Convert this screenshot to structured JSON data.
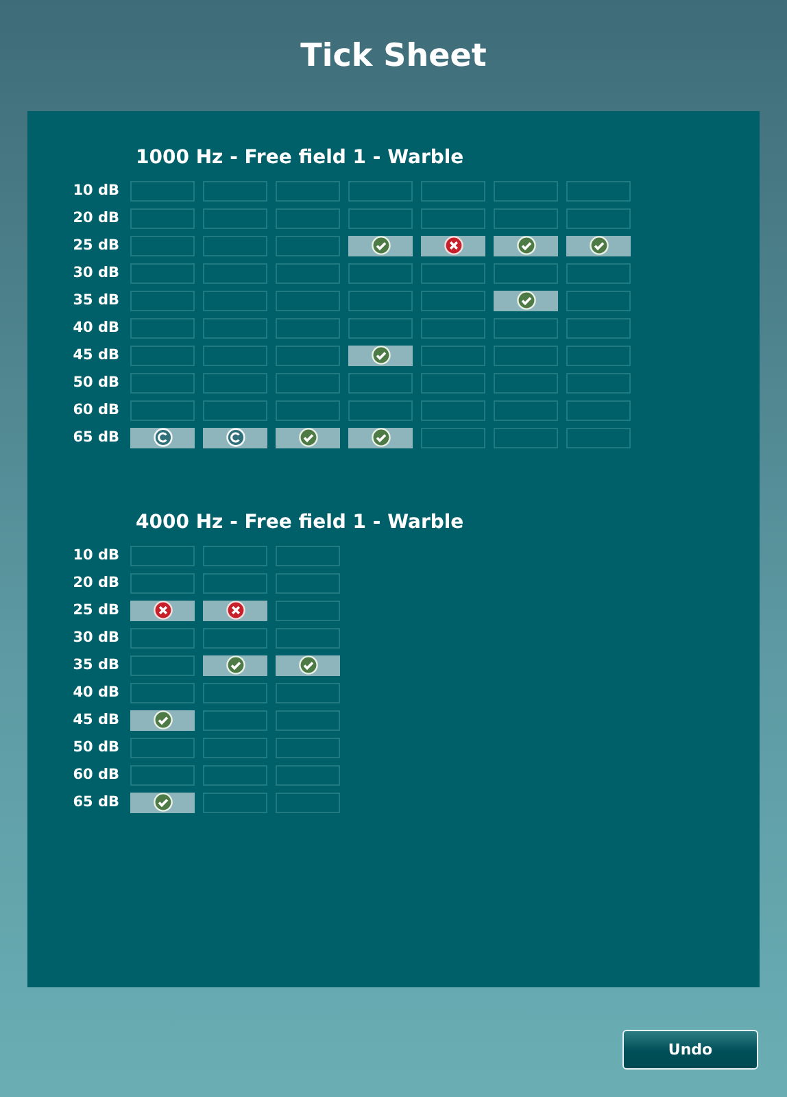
{
  "window": {
    "title": "Tick Sheet"
  },
  "sections": [
    {
      "title": "1000 Hz - Free field 1 - Warble",
      "rows": [
        {
          "label": "10 dB",
          "cells": [
            {
              "kind": "empty"
            },
            {
              "kind": "empty"
            },
            {
              "kind": "empty"
            },
            {
              "kind": "empty"
            },
            {
              "kind": "empty"
            },
            {
              "kind": "empty"
            },
            {
              "kind": "empty"
            }
          ]
        },
        {
          "label": "20 dB",
          "cells": [
            {
              "kind": "empty"
            },
            {
              "kind": "empty"
            },
            {
              "kind": "empty"
            },
            {
              "kind": "empty"
            },
            {
              "kind": "empty"
            },
            {
              "kind": "empty"
            },
            {
              "kind": "empty"
            }
          ]
        },
        {
          "label": "25 dB",
          "cells": [
            {
              "kind": "empty"
            },
            {
              "kind": "empty"
            },
            {
              "kind": "empty"
            },
            {
              "kind": "check"
            },
            {
              "kind": "cross"
            },
            {
              "kind": "check"
            },
            {
              "kind": "check"
            }
          ]
        },
        {
          "label": "30 dB",
          "cells": [
            {
              "kind": "empty"
            },
            {
              "kind": "empty"
            },
            {
              "kind": "empty"
            },
            {
              "kind": "empty"
            },
            {
              "kind": "empty"
            },
            {
              "kind": "empty"
            },
            {
              "kind": "empty"
            }
          ]
        },
        {
          "label": "35 dB",
          "cells": [
            {
              "kind": "empty"
            },
            {
              "kind": "empty"
            },
            {
              "kind": "empty"
            },
            {
              "kind": "empty"
            },
            {
              "kind": "empty"
            },
            {
              "kind": "check"
            },
            {
              "kind": "empty"
            }
          ]
        },
        {
          "label": "40 dB",
          "cells": [
            {
              "kind": "empty"
            },
            {
              "kind": "empty"
            },
            {
              "kind": "empty"
            },
            {
              "kind": "empty"
            },
            {
              "kind": "empty"
            },
            {
              "kind": "empty"
            },
            {
              "kind": "empty"
            }
          ]
        },
        {
          "label": "45 dB",
          "cells": [
            {
              "kind": "empty"
            },
            {
              "kind": "empty"
            },
            {
              "kind": "empty"
            },
            {
              "kind": "check"
            },
            {
              "kind": "empty"
            },
            {
              "kind": "empty"
            },
            {
              "kind": "empty"
            }
          ]
        },
        {
          "label": "50 dB",
          "cells": [
            {
              "kind": "empty"
            },
            {
              "kind": "empty"
            },
            {
              "kind": "empty"
            },
            {
              "kind": "empty"
            },
            {
              "kind": "empty"
            },
            {
              "kind": "empty"
            },
            {
              "kind": "empty"
            }
          ]
        },
        {
          "label": "60 dB",
          "cells": [
            {
              "kind": "empty"
            },
            {
              "kind": "empty"
            },
            {
              "kind": "empty"
            },
            {
              "kind": "empty"
            },
            {
              "kind": "empty"
            },
            {
              "kind": "empty"
            },
            {
              "kind": "empty"
            }
          ]
        },
        {
          "label": "65 dB",
          "cells": [
            {
              "kind": "circled"
            },
            {
              "kind": "circled"
            },
            {
              "kind": "check"
            },
            {
              "kind": "check"
            },
            {
              "kind": "empty"
            },
            {
              "kind": "empty"
            },
            {
              "kind": "empty"
            }
          ]
        }
      ]
    },
    {
      "title": "4000 Hz - Free field 1 - Warble",
      "rows": [
        {
          "label": "10 dB",
          "cells": [
            {
              "kind": "empty"
            },
            {
              "kind": "empty"
            },
            {
              "kind": "empty"
            }
          ]
        },
        {
          "label": "20 dB",
          "cells": [
            {
              "kind": "empty"
            },
            {
              "kind": "empty"
            },
            {
              "kind": "empty"
            }
          ]
        },
        {
          "label": "25 dB",
          "cells": [
            {
              "kind": "cross"
            },
            {
              "kind": "cross"
            },
            {
              "kind": "empty"
            }
          ]
        },
        {
          "label": "30 dB",
          "cells": [
            {
              "kind": "empty"
            },
            {
              "kind": "empty"
            },
            {
              "kind": "empty"
            }
          ]
        },
        {
          "label": "35 dB",
          "cells": [
            {
              "kind": "empty"
            },
            {
              "kind": "check"
            },
            {
              "kind": "check"
            }
          ]
        },
        {
          "label": "40 dB",
          "cells": [
            {
              "kind": "empty"
            },
            {
              "kind": "empty"
            },
            {
              "kind": "empty"
            }
          ]
        },
        {
          "label": "45 dB",
          "cells": [
            {
              "kind": "check"
            },
            {
              "kind": "empty"
            },
            {
              "kind": "empty"
            }
          ]
        },
        {
          "label": "50 dB",
          "cells": [
            {
              "kind": "empty"
            },
            {
              "kind": "empty"
            },
            {
              "kind": "empty"
            }
          ]
        },
        {
          "label": "60 dB",
          "cells": [
            {
              "kind": "empty"
            },
            {
              "kind": "empty"
            },
            {
              "kind": "empty"
            }
          ]
        },
        {
          "label": "65 dB",
          "cells": [
            {
              "kind": "check"
            },
            {
              "kind": "empty"
            },
            {
              "kind": "empty"
            }
          ]
        }
      ]
    }
  ],
  "buttons": [
    "Undo"
  ]
}
